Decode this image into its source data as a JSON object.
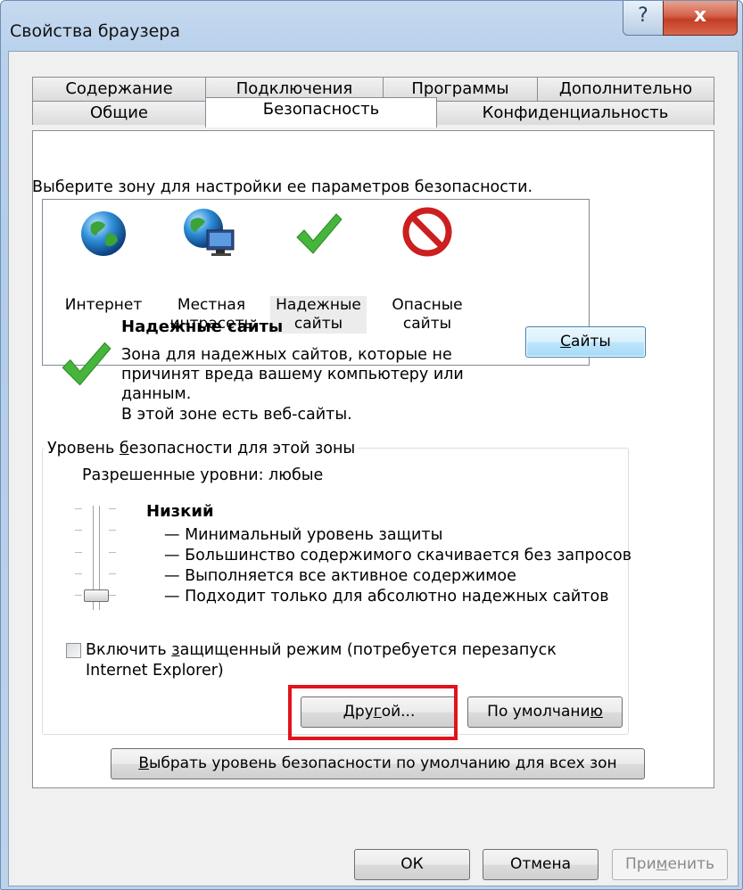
{
  "window": {
    "title": "Свойства браузера",
    "help_label": "?",
    "close_label": "x"
  },
  "tabs": {
    "row1": [
      "Содержание",
      "Подключения",
      "Программы",
      "Дополнительно"
    ],
    "row2": [
      "Общие",
      "Безопасность",
      "Конфиденциальность"
    ],
    "active": "Безопасность"
  },
  "zones": {
    "instruction": "Выберите зону для настройки ее параметров безопасности.",
    "items": [
      {
        "line1": "Интернет",
        "line2": "",
        "icon": "globe-icon"
      },
      {
        "line1": "Местная",
        "line2": "интрасеть",
        "icon": "intranet-icon"
      },
      {
        "line1": "Надежные",
        "line2": "сайты",
        "icon": "checkmark-icon"
      },
      {
        "line1": "Опасные",
        "line2": "сайты",
        "icon": "prohibited-icon"
      }
    ],
    "selected_index": 2
  },
  "zone_info": {
    "title": "Надежные сайты",
    "desc1": "Зона для надежных сайтов, которые не",
    "desc2": "причинят вреда вашему компьютеру или",
    "desc3": "данным.",
    "desc4": "В этой зоне есть веб-сайты.",
    "sites_button_pre": "",
    "sites_button_ul": "С",
    "sites_button_post": "айты"
  },
  "security_level": {
    "legend_pre": "Уровень ",
    "legend_ul": "б",
    "legend_post": "езопасности для этой зоны",
    "allowed": "Разрешенные уровни: любые",
    "level_name": "Низкий",
    "level_index": 0,
    "level_count": 5,
    "bullets": [
      "— Минимальный уровень защиты",
      "— Большинство содержимого скачивается без запросов",
      "— Выполняется все активное содержимое",
      "— Подходит только для абсолютно надежных сайтов"
    ],
    "protected_mode_pre": "Включить ",
    "protected_mode_ul": "з",
    "protected_mode_post": "ащищенный режим (потребуется перезапуск",
    "protected_mode_line2": "Internet Explorer)",
    "protected_mode_checked": false,
    "custom_pre": "Дру",
    "custom_ul": "г",
    "custom_post": "ой...",
    "default_pre": "По умолчани",
    "default_ul": "ю",
    "default_post": ""
  },
  "reset_all": {
    "pre": "",
    "ul": "В",
    "post": "ыбрать уровень безопасности по умолчанию для всех зон"
  },
  "footer": {
    "ok": "ОК",
    "cancel": "Отмена",
    "apply_pre": "При",
    "apply_ul": "м",
    "apply_post": "енить"
  },
  "colors": {
    "highlight_border": "#e0141c",
    "title_bar": "#b9d1ec",
    "close_button": "#c33d25"
  }
}
